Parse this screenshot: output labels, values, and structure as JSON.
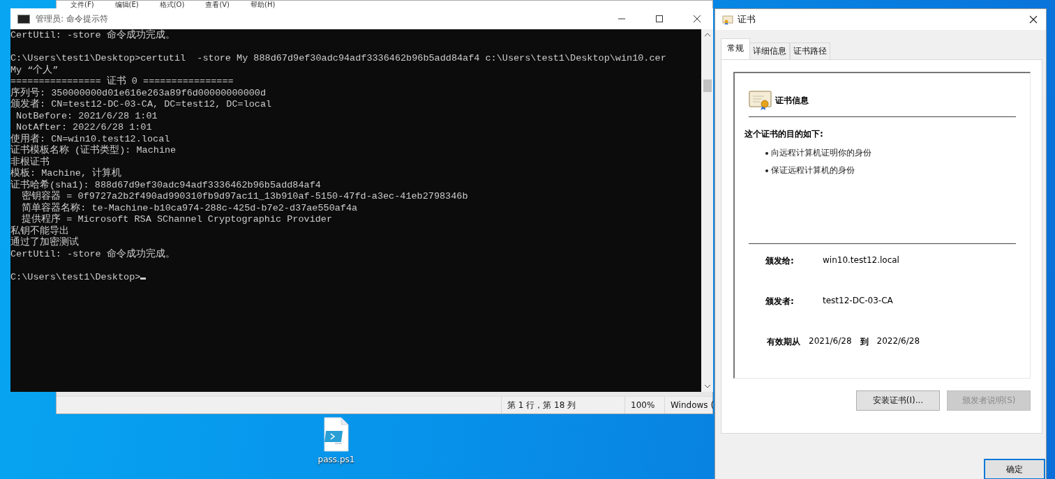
{
  "notepad": {
    "menu": [
      "文件(F)",
      "编辑(E)",
      "格式(O)",
      "查看(V)",
      "帮助(H)"
    ],
    "status_bar": [
      "第 1 行，第 18 列",
      "100%",
      "Windows ("
    ]
  },
  "terminal": {
    "title": "管理员: 命令提示符",
    "blocks": [
      [
        "CertUtil: -store 命令成功完成。"
      ],
      [
        "C:\\Users\\test1\\Desktop>certutil  -store My 888d67d9ef30adc94adf3336462b96b5add84af4 c:\\Users\\test1\\Desktop\\win10.cer",
        "My “个人”",
        "================ 证书 0 ================",
        "序列号: 350000000d01e616e263a89f6d00000000000d",
        "颁发者: CN=test12-DC-03-CA, DC=test12, DC=local",
        " NotBefore: 2021/6/28 1:01",
        " NotAfter: 2022/6/28 1:01",
        "使用者: CN=win10.test12.local",
        "证书模板名称 (证书类型): Machine",
        "非根证书",
        "模板: Machine, 计算机",
        "证书哈希(sha1): 888d67d9ef30adc94adf3336462b96b5add84af4",
        "  密钥容器 = 0f9727a2b2f490ad990310fb9d97ac11_13b910af-5150-47fd-a3ec-41eb2798346b",
        "  简单容器名称: te-Machine-b10ca974-288c-425d-b7e2-d37ae550af4a",
        "  提供程序 = Microsoft RSA SChannel Cryptographic Provider",
        "私钥不能导出",
        "通过了加密测试",
        "CertUtil: -store 命令成功完成。"
      ],
      [
        "C:\\Users\\test1\\Desktop>"
      ]
    ]
  },
  "cert_dialog": {
    "title": "证书",
    "tabs": [
      {
        "label": "常规",
        "selected": true
      },
      {
        "label": "详细信息",
        "selected": false
      },
      {
        "label": "证书路径",
        "selected": false
      }
    ],
    "heading": "证书信息",
    "purpose_title": "这个证书的目的如下:",
    "purposes": [
      "向远程计算机证明你的身份",
      "保证远程计算机的身份"
    ],
    "fields": [
      {
        "label": "颁发给:",
        "value": "win10.test12.local"
      },
      {
        "label": "颁发者:",
        "value": "test12-DC-03-CA"
      }
    ],
    "validity": {
      "label": "有效期从",
      "from": "2021/6/28",
      "to_word": "到",
      "to": "2022/6/28"
    },
    "buttons": [
      {
        "label": "安装证书(I)...",
        "disabled": false
      },
      {
        "label": "颁发者说明(S)",
        "disabled": true
      }
    ],
    "ok_button": "确定"
  },
  "desktop_icons": [
    {
      "label": "pass.ps1"
    }
  ]
}
